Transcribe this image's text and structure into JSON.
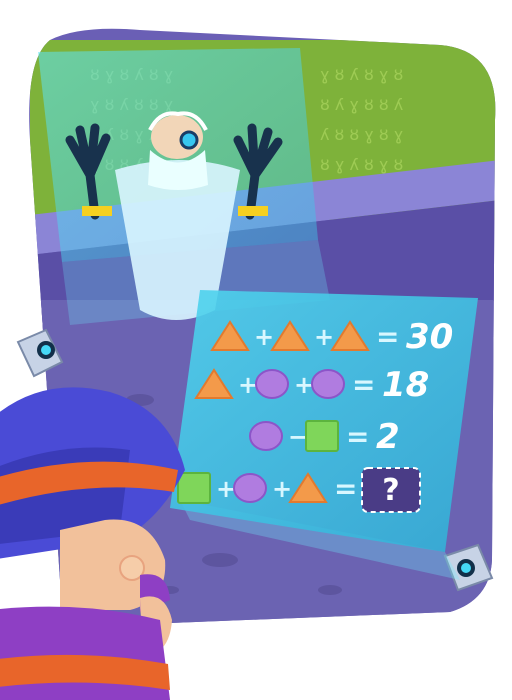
{
  "puzzle": {
    "rows": [
      {
        "terms": [
          "triangle",
          "+",
          "triangle",
          "+",
          "triangle"
        ],
        "result": "30"
      },
      {
        "terms": [
          "triangle",
          "+",
          "circle",
          "+",
          "circle"
        ],
        "result": "18"
      },
      {
        "terms": [
          "circle",
          "−",
          "square"
        ],
        "result": "2"
      },
      {
        "terms": [
          "square",
          "+",
          "circle",
          "+",
          "triangle"
        ],
        "result": "?"
      }
    ],
    "equals": "=",
    "unknown_symbol": "?"
  },
  "colors": {
    "triangle": "#f39a4a",
    "circle": "#b07ce0",
    "square": "#7fd65a",
    "hologram": "#52e0f5",
    "wall": "#6a5fb5",
    "backdrop": "#7eb23a"
  },
  "characters": [
    "villain-scientist",
    "ninja-kid"
  ],
  "devices": [
    "hologram-projector-left",
    "hologram-projector-right"
  ]
}
